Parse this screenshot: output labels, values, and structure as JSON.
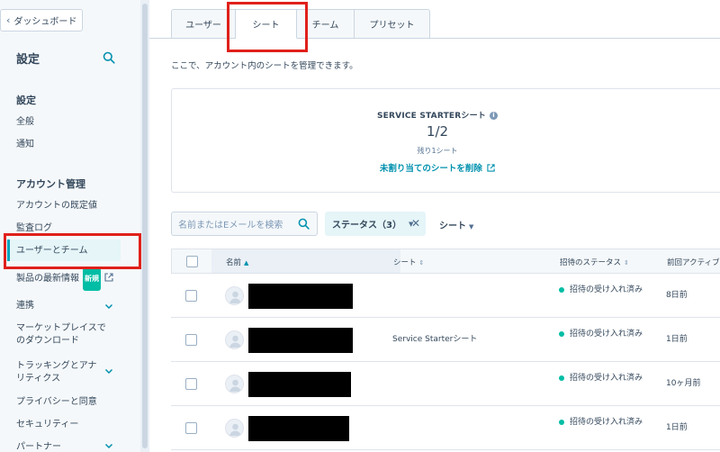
{
  "sidebar": {
    "back_label": "ダッシュボード",
    "title": "設定",
    "section_settings": "設定",
    "item_general": "全般",
    "item_notifications": "通知",
    "section_account": "アカウント管理",
    "item_defaults": "アカウントの既定値",
    "item_audit": "監査ログ",
    "item_users_teams": "ユーザーとチーム",
    "item_product_updates": "製品の最新情報",
    "new_badge": "新規",
    "item_integrations": "連携",
    "item_marketplace": "マーケットプレイスでのダウンロード",
    "item_tracking": "トラッキングとアナリティクス",
    "item_privacy": "プライバシーと同意",
    "item_security": "セキュリティー",
    "item_partner": "パートナー"
  },
  "tabs": [
    {
      "label": "ユーザー"
    },
    {
      "label": "シート"
    },
    {
      "label": "チーム"
    },
    {
      "label": "プリセット"
    }
  ],
  "description": "ここで、アカウント内のシートを管理できます。",
  "seat_card": {
    "title": "SERVICE STARTERシート",
    "count": "1/2",
    "remaining": "残り1シート",
    "delete_link": "未割り当てのシートを削除"
  },
  "toolbar": {
    "search_placeholder": "名前またはEメールを検索",
    "status_filter": "ステータス（3）",
    "seat_filter": "シート"
  },
  "table": {
    "headers": {
      "name": "名前",
      "seat": "シート",
      "invite_status": "招待のステータス",
      "last_active": "前回アクティブ"
    },
    "rows": [
      {
        "seat": "",
        "status": "招待の受け入れ済み",
        "last_active": "8日前"
      },
      {
        "seat": "Service Starterシート",
        "status": "招待の受け入れ済み",
        "last_active": "1日前"
      },
      {
        "seat": "",
        "status": "招待の受け入れ済み",
        "last_active": "10ヶ月前"
      },
      {
        "seat": "",
        "status": "招待の受け入れ済み",
        "last_active": "1日前"
      }
    ]
  },
  "colors": {
    "accent": "#00a4bd",
    "link": "#0091ae",
    "success": "#00bda5",
    "highlight": "#e0201b"
  }
}
